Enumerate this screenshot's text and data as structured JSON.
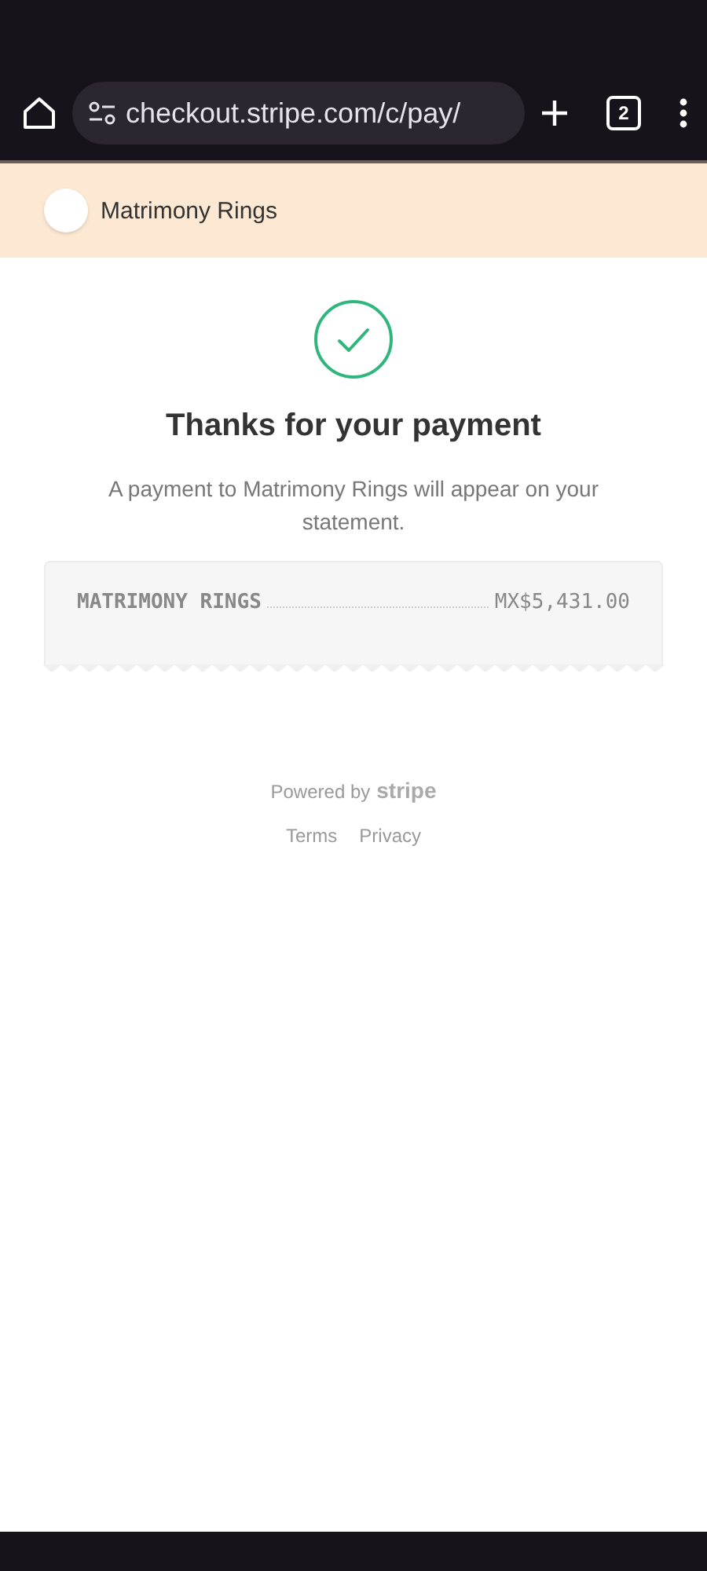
{
  "browser": {
    "url": "checkout.stripe.com/c/pay/",
    "tab_count": "2"
  },
  "merchant": {
    "name": "Matrimony Rings"
  },
  "confirmation": {
    "title": "Thanks for your payment",
    "message": "A payment to Matrimony Rings will appear on your statement."
  },
  "receipt": {
    "line_items": [
      {
        "label": "MATRIMONY RINGS",
        "amount": "MX$5,431.00"
      }
    ]
  },
  "footer": {
    "powered_by": "Powered by",
    "brand": "stripe",
    "links": [
      "Terms",
      "Privacy"
    ]
  }
}
